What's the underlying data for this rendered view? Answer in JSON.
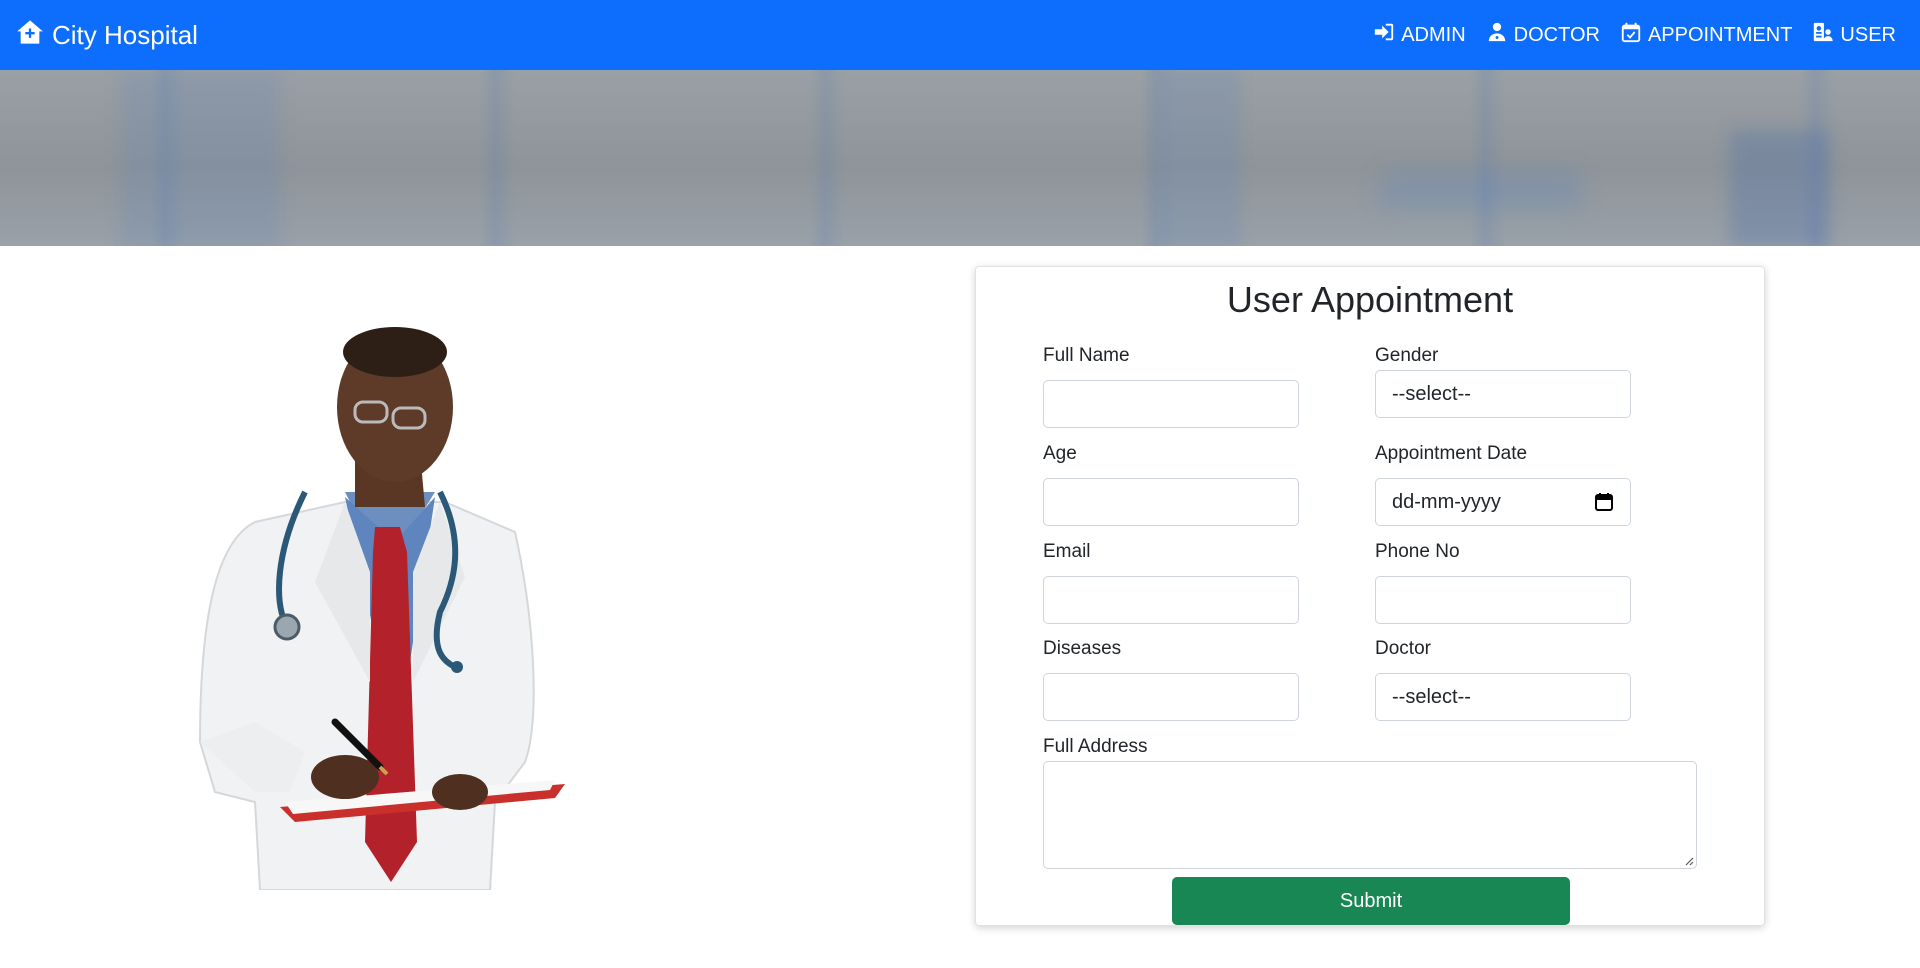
{
  "navbar": {
    "brand": "City Hospital",
    "links": [
      {
        "label": "ADMIN",
        "icon": "login-icon"
      },
      {
        "label": "DOCTOR",
        "icon": "doctor-icon"
      },
      {
        "label": "APPOINTMENT",
        "icon": "calendar-check-icon"
      },
      {
        "label": "USER",
        "icon": "user-id-icon"
      }
    ],
    "colors": {
      "background": "#0d6efd",
      "text": "#ffffff"
    }
  },
  "form": {
    "title": "User Appointment",
    "fields": {
      "full_name": {
        "label": "Full Name",
        "value": ""
      },
      "gender": {
        "label": "Gender",
        "value": "--select--"
      },
      "age": {
        "label": "Age",
        "value": ""
      },
      "appointment_date": {
        "label": "Appointment Date",
        "placeholder": "dd-mm-yyyy"
      },
      "email": {
        "label": "Email",
        "value": ""
      },
      "phone": {
        "label": "Phone No",
        "value": ""
      },
      "diseases": {
        "label": "Diseases",
        "value": ""
      },
      "doctor": {
        "label": "Doctor",
        "value": "--select--"
      },
      "full_address": {
        "label": "Full Address",
        "value": ""
      }
    },
    "submit_label": "Submit",
    "colors": {
      "submit": "#198754"
    }
  }
}
